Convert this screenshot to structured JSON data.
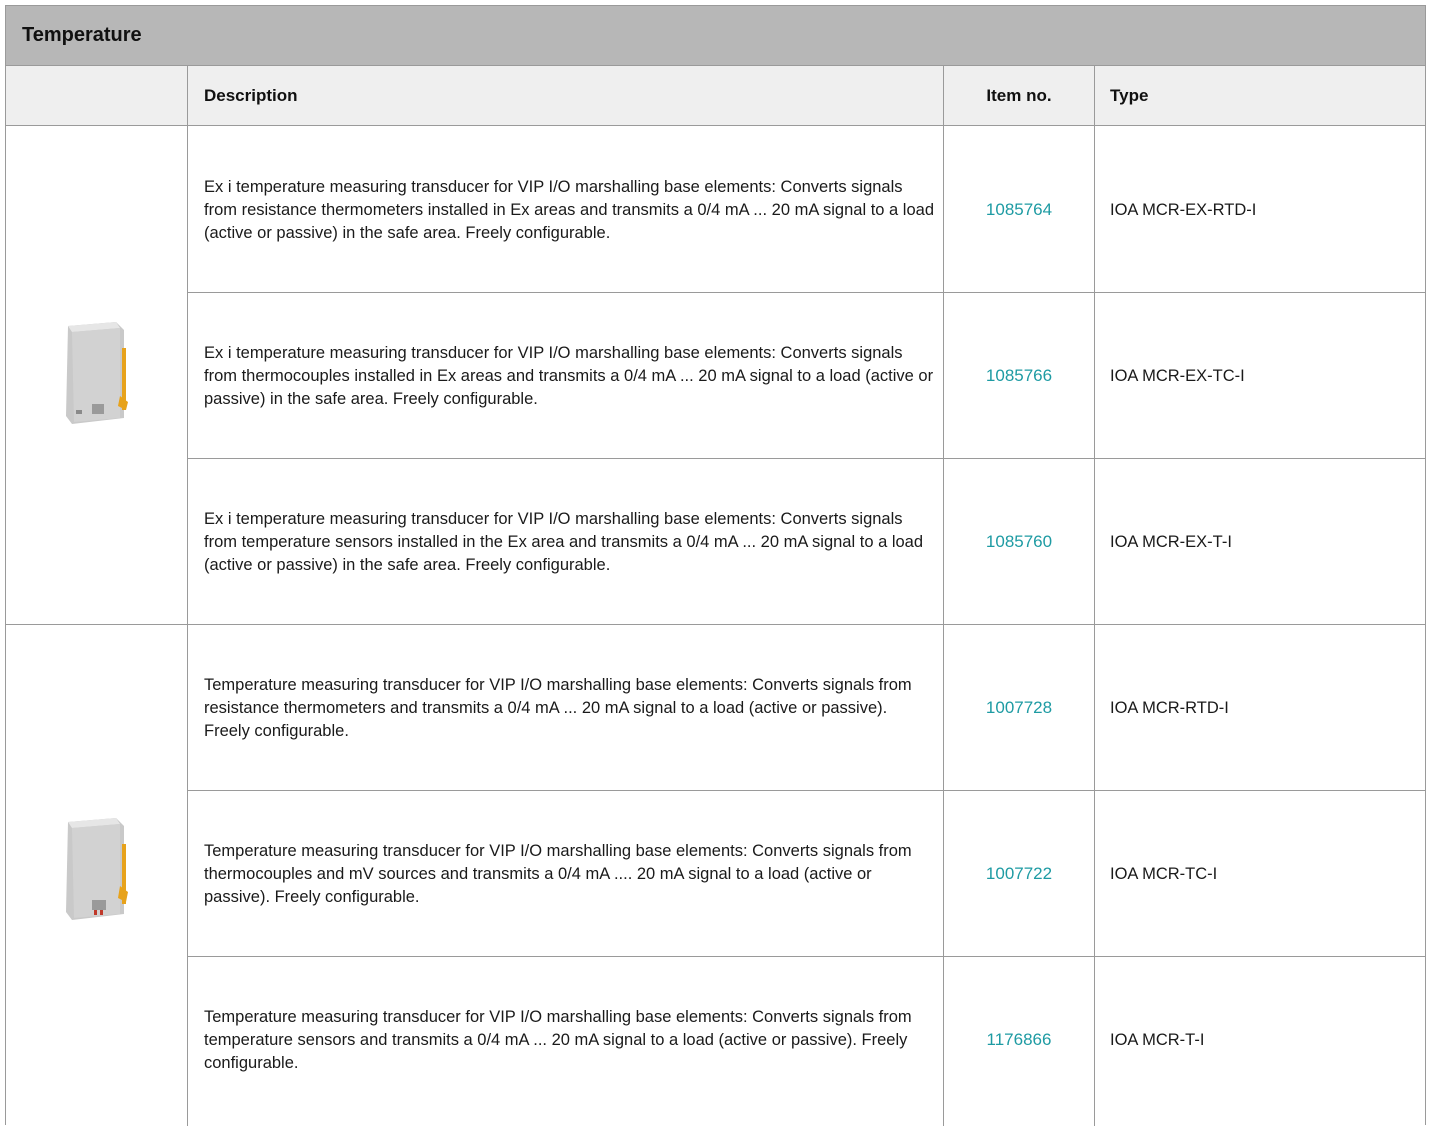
{
  "section_title": "Temperature",
  "columns": {
    "description": "Description",
    "item_no": "Item no.",
    "type": "Type"
  },
  "groups": [
    {
      "image": "product-module-grey-ex",
      "rows": [
        {
          "description": "Ex i temperature measuring transducer for VIP I/O marshalling base elements: Converts signals from resistance thermometers installed in Ex areas and transmits a 0/4 mA ... 20 mA signal to a load (active or passive) in the safe area. Freely configurable.",
          "item_no": "1085764",
          "type": "IOA MCR-EX-RTD-I"
        },
        {
          "description": "Ex i temperature measuring transducer for VIP I/O marshalling base elements: Converts signals from thermocouples installed in Ex areas and transmits a 0/4 mA ... 20 mA signal to a load (active or passive) in the safe area. Freely configurable.",
          "item_no": "1085766",
          "type": "IOA MCR-EX-TC-I"
        },
        {
          "description": "Ex i temperature measuring transducer for VIP I/O marshalling base elements: Converts signals from temperature sensors installed in the Ex area and transmits a 0/4 mA ... 20 mA signal to a load (active or passive) in the safe area. Freely configurable.",
          "item_no": "1085760",
          "type": "IOA MCR-EX-T-I"
        }
      ]
    },
    {
      "image": "product-module-grey",
      "rows": [
        {
          "description": "Temperature measuring transducer for VIP I/O marshalling base elements: Converts signals from resistance thermometers and transmits a 0/4 mA ... 20 mA signal to a load (active or passive). Freely configurable.",
          "item_no": "1007728",
          "type": "IOA MCR-RTD-I"
        },
        {
          "description": "Temperature measuring transducer for VIP I/O marshalling base elements: Converts signals from thermocouples and mV sources and transmits a 0/4 mA .... 20 mA signal to a load (active or passive). Freely configurable.",
          "item_no": "1007722",
          "type": "IOA MCR-TC-I"
        },
        {
          "description": "Temperature measuring transducer for VIP I/O marshalling base elements: Converts signals from temperature sensors and transmits a 0/4 mA ... 20 mA signal to a load (active or passive). Freely configurable.",
          "item_no": "1176866",
          "type": "IOA MCR-T-I"
        }
      ]
    }
  ],
  "colors": {
    "title_bg": "#b7b7b7",
    "header_bg": "#efefef",
    "link": "#1e9ba3",
    "border": "#9a9a9a"
  }
}
